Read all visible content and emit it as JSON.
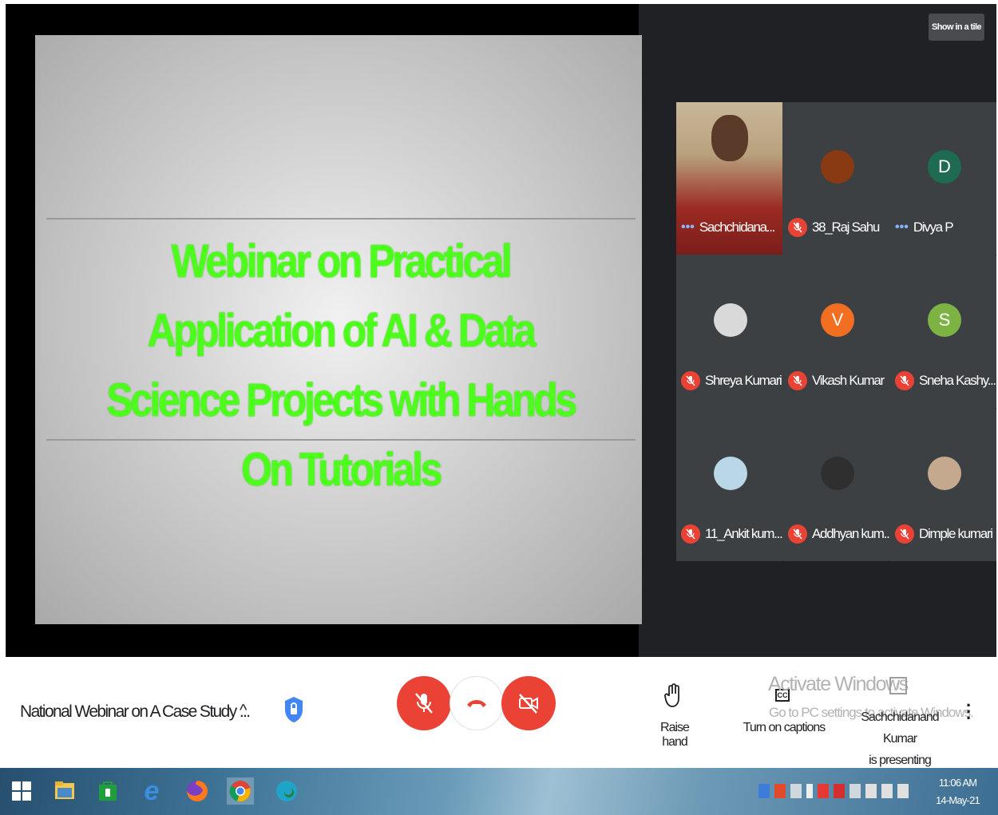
{
  "meeting": {
    "name": "National Webinar on A Case Study ...",
    "show_tile_label": "Show in a tile",
    "presenter_line1": "Sachchidanand Kumar",
    "presenter_line2": "is presenting"
  },
  "slide": {
    "title": "Webinar on Practical Application of AI & Data Science Projects with Hands On Tutorials"
  },
  "participants": [
    {
      "name": "Sachchidana...",
      "status": "dots",
      "avatar_type": "video"
    },
    {
      "name": "38_Raj Sahu",
      "status": "muted",
      "avatar_type": "photo",
      "color": "#8a3a12"
    },
    {
      "name": "Divya P",
      "status": "dots",
      "avatar_type": "letter",
      "letter": "D",
      "color": "#1e6b52"
    },
    {
      "name": "Shreya Kumari",
      "status": "muted",
      "avatar_type": "photo",
      "color": "#d9d9d9"
    },
    {
      "name": "Vikash Kumar",
      "status": "muted",
      "avatar_type": "letter",
      "letter": "V",
      "color": "#f26f21"
    },
    {
      "name": "Sneha Kashy...",
      "status": "muted",
      "avatar_type": "letter",
      "letter": "S",
      "color": "#7cb342"
    },
    {
      "name": "11_Ankit kum...",
      "status": "muted",
      "avatar_type": "photo",
      "color": "#b9d7e6"
    },
    {
      "name": "Addhyan kum...",
      "status": "muted",
      "avatar_type": "photo",
      "color": "#2f2f2f"
    },
    {
      "name": "Dimple kumari",
      "status": "muted",
      "avatar_type": "photo",
      "color": "#c4a98f"
    }
  ],
  "controls": {
    "raise_hand_label": "Raise hand",
    "captions_label": "Turn on captions",
    "mic_color": "#ea4335",
    "camera_color": "#ea4335"
  },
  "watermark": {
    "title": "Activate Windows",
    "subtitle": "Go to PC settings to activate Windows."
  },
  "taskbar": {
    "time": "11:06 AM",
    "date": "14-May-21"
  }
}
